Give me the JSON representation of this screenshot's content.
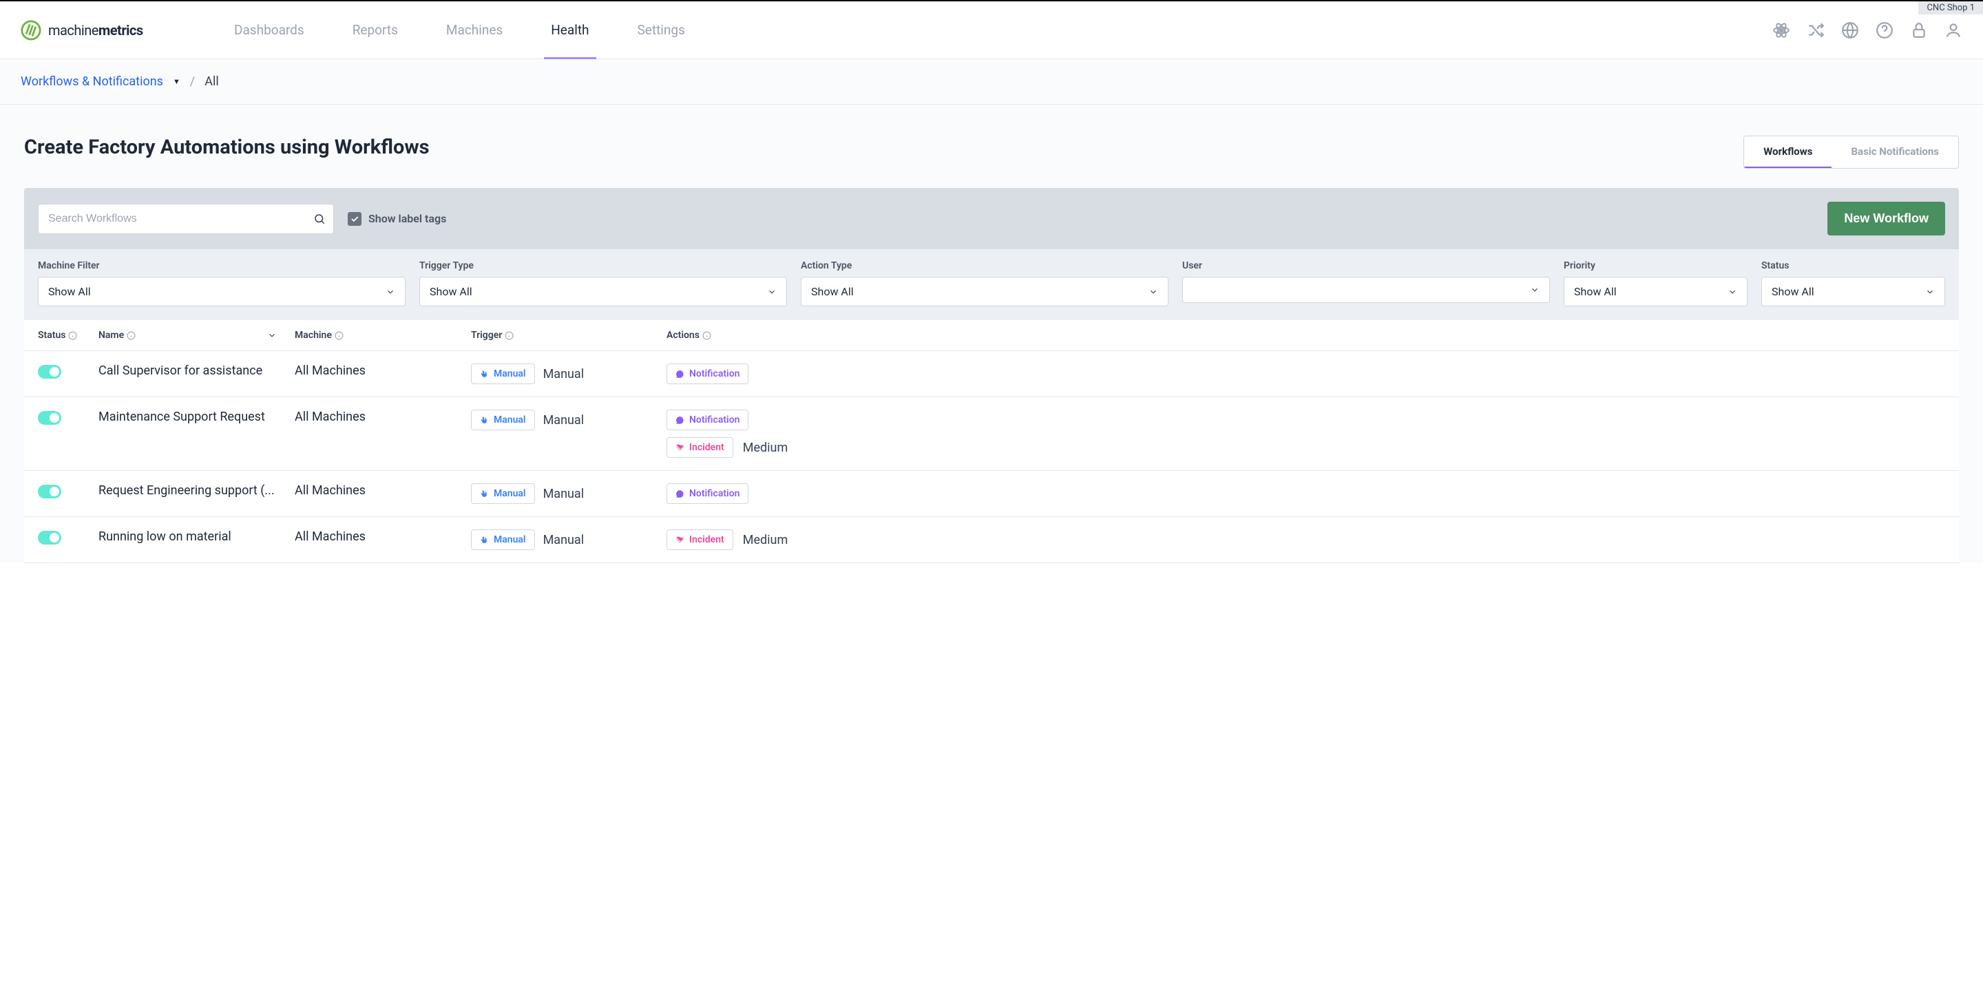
{
  "topTag": "CNC Shop 1",
  "logo": {
    "brand": "machine",
    "brandBold": "metrics"
  },
  "nav": {
    "dashboards": "Dashboards",
    "reports": "Reports",
    "machines": "Machines",
    "health": "Health",
    "settings": "Settings"
  },
  "breadcrumb": {
    "link": "Workflows & Notifications",
    "current": "All"
  },
  "page": {
    "title": "Create Factory Automations using Workflows",
    "tabs": {
      "workflows": "Workflows",
      "notifications": "Basic Notifications"
    }
  },
  "toolbar": {
    "searchPlaceholder": "Search Workflows",
    "checkboxLabel": "Show label tags",
    "newBtn": "New Workflow"
  },
  "filters": {
    "machineFilter": {
      "label": "Machine Filter",
      "value": "Show All"
    },
    "triggerType": {
      "label": "Trigger Type",
      "value": "Show All"
    },
    "actionType": {
      "label": "Action Type",
      "value": "Show All"
    },
    "user": {
      "label": "User",
      "value": ""
    },
    "priority": {
      "label": "Priority",
      "value": "Show All"
    },
    "status": {
      "label": "Status",
      "value": "Show All"
    }
  },
  "columns": {
    "status": "Status",
    "name": "Name",
    "machine": "Machine",
    "trigger": "Trigger",
    "actions": "Actions"
  },
  "badges": {
    "manual": "Manual",
    "notification": "Notification",
    "incident": "Incident"
  },
  "rows": [
    {
      "name": "Call Supervisor for assistance",
      "machine": "All Machines",
      "triggerBadge": "Manual",
      "triggerText": "Manual",
      "actions": [
        {
          "badge": "Notification"
        }
      ]
    },
    {
      "name": "Maintenance Support Request",
      "machine": "All Machines",
      "triggerBadge": "Manual",
      "triggerText": "Manual",
      "actions": [
        {
          "badge": "Notification"
        },
        {
          "badge": "Incident",
          "priority": "Medium"
        }
      ]
    },
    {
      "name": "Request Engineering support (...",
      "machine": "All Machines",
      "triggerBadge": "Manual",
      "triggerText": "Manual",
      "actions": [
        {
          "badge": "Notification"
        }
      ]
    },
    {
      "name": "Running low on material",
      "machine": "All Machines",
      "triggerBadge": "Manual",
      "triggerText": "Manual",
      "actions": [
        {
          "badge": "Incident",
          "priority": "Medium"
        }
      ]
    }
  ]
}
